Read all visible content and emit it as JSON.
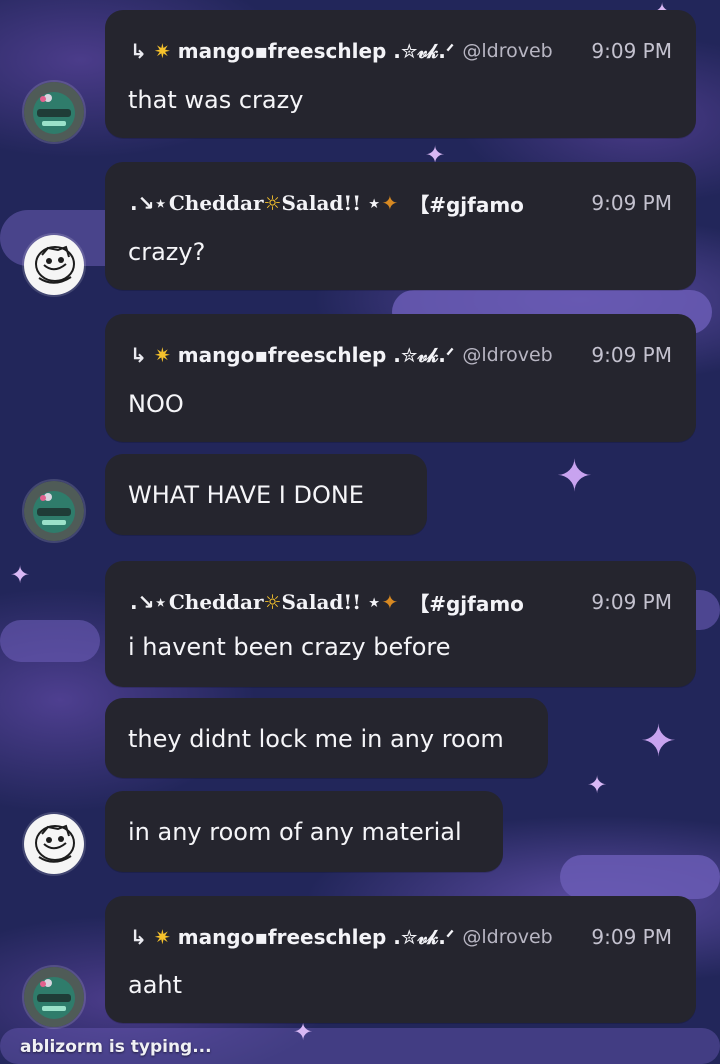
{
  "messages": [
    {
      "author": "mango▪freeschlep .",
      "deco": "✮𝓋𝓀.ᐟ",
      "handle": "@ldroveb",
      "time": "9:09 PM",
      "text": "that was crazy"
    },
    {
      "author_prefix": ".↘⋆",
      "author": "Cheddar",
      "author_suffix": "Salad!! ⋆",
      "tag": "【#gjfamo",
      "time": "9:09 PM",
      "text": "crazy?"
    },
    {
      "author": "mango▪freeschlep .",
      "deco": "✮𝓋𝓀.ᐟ",
      "handle": "@ldroveb",
      "time": "9:09 PM",
      "text": "NOO"
    },
    {
      "text": "WHAT HAVE I DONE"
    },
    {
      "author_prefix": ".↘⋆",
      "author": "Cheddar",
      "author_suffix": "Salad!! ⋆",
      "tag": "【#gjfamo",
      "time": "9:09 PM",
      "text": "i havent been crazy before"
    },
    {
      "text": "they didnt lock me in any room"
    },
    {
      "text": "in any room of any material"
    },
    {
      "author": "mango▪freeschlep .",
      "deco": "✮𝓋𝓀.ᐟ",
      "handle": "@ldroveb",
      "time": "9:09 PM",
      "text": "aaht"
    }
  ],
  "typing_indicator": "ablizorm is typing...",
  "icons": {
    "reply": "↳",
    "sun": "☼",
    "paw": "🐾",
    "bone": "🦴",
    "star": "✦"
  },
  "colors": {
    "bubble": "#25252e",
    "background": "#22265a",
    "cloud": "#6a5cb5",
    "star": "#c8a3ef"
  }
}
